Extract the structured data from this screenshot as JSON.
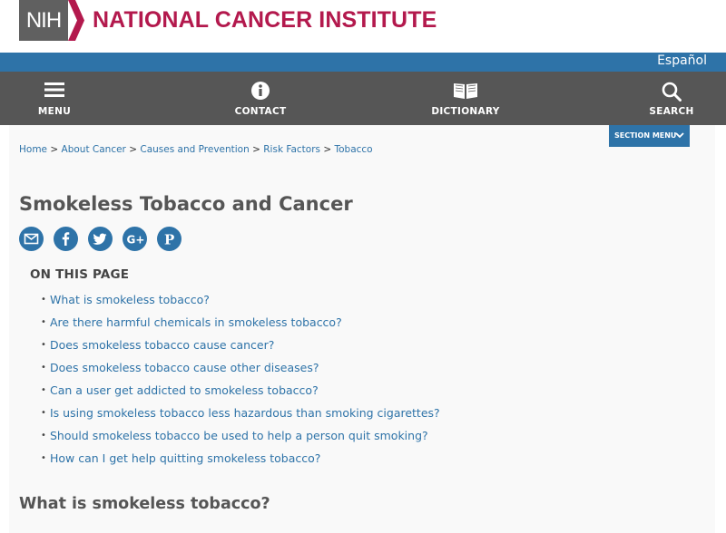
{
  "header": {
    "logo_abbr": "NIH",
    "site_name": "NATIONAL CANCER INSTITUTE",
    "colors": {
      "brand_red": "#b3194d",
      "logo_gray": "#606060",
      "link_blue": "#2e73a8",
      "nav_gray": "#565656"
    }
  },
  "lang_bar": {
    "espanol_label": "Español"
  },
  "nav": {
    "items": [
      {
        "label": "MENU",
        "icon": "hamburger-icon"
      },
      {
        "label": "CONTACT",
        "icon": "info-icon"
      },
      {
        "label": "DICTIONARY",
        "icon": "book-icon"
      },
      {
        "label": "SEARCH",
        "icon": "search-icon"
      }
    ]
  },
  "breadcrumb": {
    "items": [
      "Home",
      "About Cancer",
      "Causes and Prevention",
      "Risk Factors",
      "Tobacco"
    ],
    "separator": ">"
  },
  "section_menu": {
    "label": "SECTION MENU",
    "icon": "chevron-down-icon"
  },
  "page": {
    "title": "Smokeless Tobacco and Cancer",
    "share_icons": [
      "email-icon",
      "facebook-icon",
      "twitter-icon",
      "google-plus-icon",
      "pinterest-icon"
    ],
    "on_this_page_heading": "ON THIS PAGE",
    "toc": [
      "What is smokeless tobacco?",
      "Are there harmful chemicals in smokeless tobacco?",
      "Does smokeless tobacco cause cancer?",
      "Does smokeless tobacco cause other diseases?",
      "Can a user get addicted to smokeless tobacco?",
      "Is using smokeless tobacco less hazardous than smoking cigarettes?",
      "Should smokeless tobacco be used to help a person quit smoking?",
      "How can I get help quitting smokeless tobacco?"
    ],
    "bullet": "•",
    "section_heading": "What is smokeless tobacco?"
  }
}
